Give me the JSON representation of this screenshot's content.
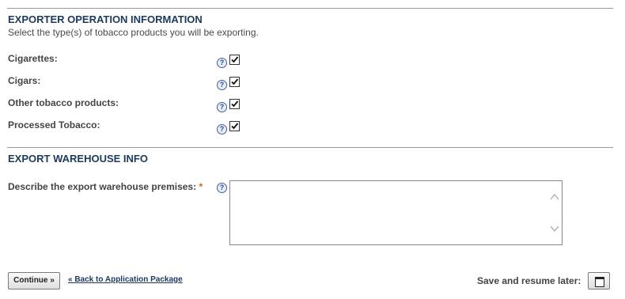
{
  "section1": {
    "title": "EXPORTER OPERATION INFORMATION",
    "subtitle": "Select the type(s) of tobacco products you will be exporting."
  },
  "products": [
    {
      "label": "Cigarettes:",
      "checked": true
    },
    {
      "label": "Cigars:",
      "checked": true
    },
    {
      "label": "Other tobacco products:",
      "checked": true
    },
    {
      "label": "Processed Tobacco:",
      "checked": true
    }
  ],
  "section2": {
    "title": "EXPORT WAREHOUSE INFO",
    "premises_label": "Describe the export warehouse premises:",
    "required_mark": "*",
    "premises_value": ""
  },
  "help_glyph": "?",
  "footer": {
    "continue_label": "Continue »",
    "back_link": "« Back to Application Package",
    "save_label": "Save and resume later:"
  }
}
